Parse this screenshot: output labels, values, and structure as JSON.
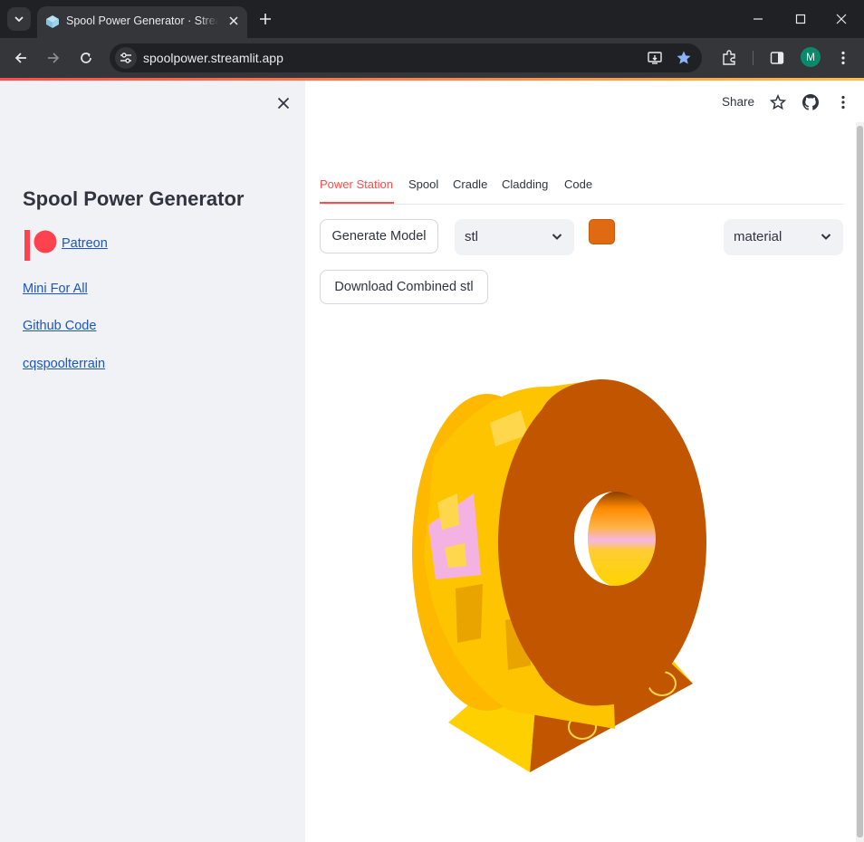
{
  "browser": {
    "tab_title": "Spool Power Generator · Streamlit",
    "url": "spoolpower.streamlit.app",
    "profile_initial": "M"
  },
  "sidebar": {
    "title": "Spool Power Generator",
    "links": {
      "patreon": "Patreon",
      "mini_for_all": "Mini For All",
      "github_code": "Github Code",
      "cqspoolterrain": "cqspoolterrain"
    }
  },
  "header": {
    "share_label": "Share"
  },
  "tabs": [
    "Power Station",
    "Spool",
    "Cradle",
    "Cladding",
    "Code"
  ],
  "controls": {
    "generate_label": "Generate Model",
    "format_value": "stl",
    "color_value": "#e06a12",
    "material_value": "material",
    "download_label": "Download Combined stl"
  },
  "colors": {
    "accent": "#ff4b4b",
    "link": "#1a56c5",
    "model_primary": "#c45a00",
    "model_secondary": "#ffcc00"
  }
}
